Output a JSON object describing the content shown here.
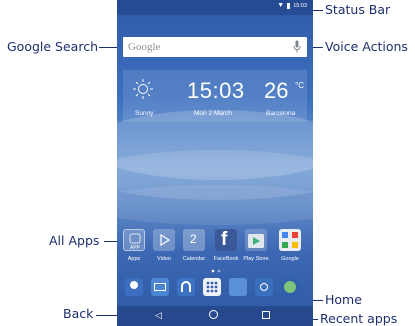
{
  "callouts": {
    "status_bar": "Status Bar",
    "google_search": "Google Search",
    "voice_actions": "Voice Actions",
    "all_apps": "All Apps",
    "back": "Back",
    "home": "Home",
    "recent_apps": "Recent apps"
  },
  "status_bar": {
    "time": "15:03"
  },
  "search": {
    "placeholder": "Google",
    "icon": "mic-icon"
  },
  "widget": {
    "time": "15:03",
    "date": "Mon 2 March",
    "temperature": "26",
    "unit": "°C",
    "condition": "Sunny",
    "city": "Barcelona"
  },
  "apps": [
    {
      "label": "Apps",
      "icon": "apps-folder-icon"
    },
    {
      "label": "Video",
      "icon": "play-icon"
    },
    {
      "label": "Calendar",
      "icon": "calendar-icon",
      "day": "2"
    },
    {
      "label": "FaceBook",
      "icon": "facebook-icon"
    },
    {
      "label": "Play Store",
      "icon": "play-store-icon"
    },
    {
      "label": "Google",
      "icon": "google-folder-icon"
    }
  ],
  "dock": [
    "contacts-icon",
    "messages-icon",
    "music-icon",
    "all-apps-icon",
    "gallery-icon",
    "camera-icon",
    "browser-icon"
  ],
  "colors": {
    "callout": "#1e2f6e",
    "wallpaper": "#3d70bf",
    "facebook": "#3b5998"
  }
}
